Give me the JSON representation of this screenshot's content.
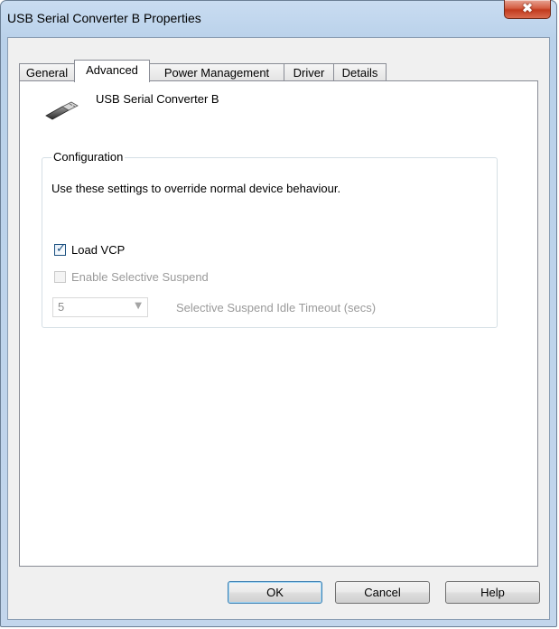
{
  "window": {
    "title": "USB Serial Converter B Properties"
  },
  "titlebar": {
    "close_glyph": "✖"
  },
  "tabs": [
    {
      "label": "General",
      "active": false
    },
    {
      "label": "Advanced",
      "active": true
    },
    {
      "label": "Power Management",
      "active": false
    },
    {
      "label": "Driver",
      "active": false
    },
    {
      "label": "Details",
      "active": false
    }
  ],
  "device": {
    "name": "USB Serial Converter B",
    "icon": "usb-plug-icon"
  },
  "configuration": {
    "legend": "Configuration",
    "description": "Use these settings to override normal device behaviour.",
    "load_vcp": {
      "label": "Load VCP",
      "checked": true,
      "enabled": true
    },
    "selective_suspend": {
      "label": "Enable Selective Suspend",
      "checked": false,
      "enabled": false
    },
    "idle_timeout": {
      "value": "5",
      "label": "Selective Suspend Idle Timeout (secs)",
      "enabled": false
    }
  },
  "buttons": {
    "ok": "OK",
    "cancel": "Cancel",
    "help": "Help"
  },
  "colors": {
    "accent": "#1c5180",
    "window_frame": "#b9d1ea",
    "close_button": "#c23a1d"
  }
}
